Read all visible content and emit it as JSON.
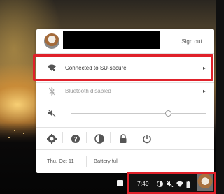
{
  "header": {
    "signout_label": "Sign out"
  },
  "network": {
    "label": "Connected to SU-secure"
  },
  "bluetooth": {
    "label": "Bluetooth disabled"
  },
  "volume": {
    "level": 0.72
  },
  "footer": {
    "date": "Thu, Oct 11",
    "battery": "Battery full"
  },
  "tray": {
    "time": "7:49"
  },
  "icons": {
    "wifi": "wifi-icon",
    "bluetooth": "bluetooth-icon",
    "mute": "volume-mute-icon",
    "settings": "gear-icon",
    "help": "help-icon",
    "night_light": "night-light-icon",
    "lock": "lock-icon",
    "power": "power-icon",
    "chevron": "chevron-right-icon"
  },
  "colors": {
    "highlight": "#e0212a",
    "panel": "#ffffff"
  }
}
